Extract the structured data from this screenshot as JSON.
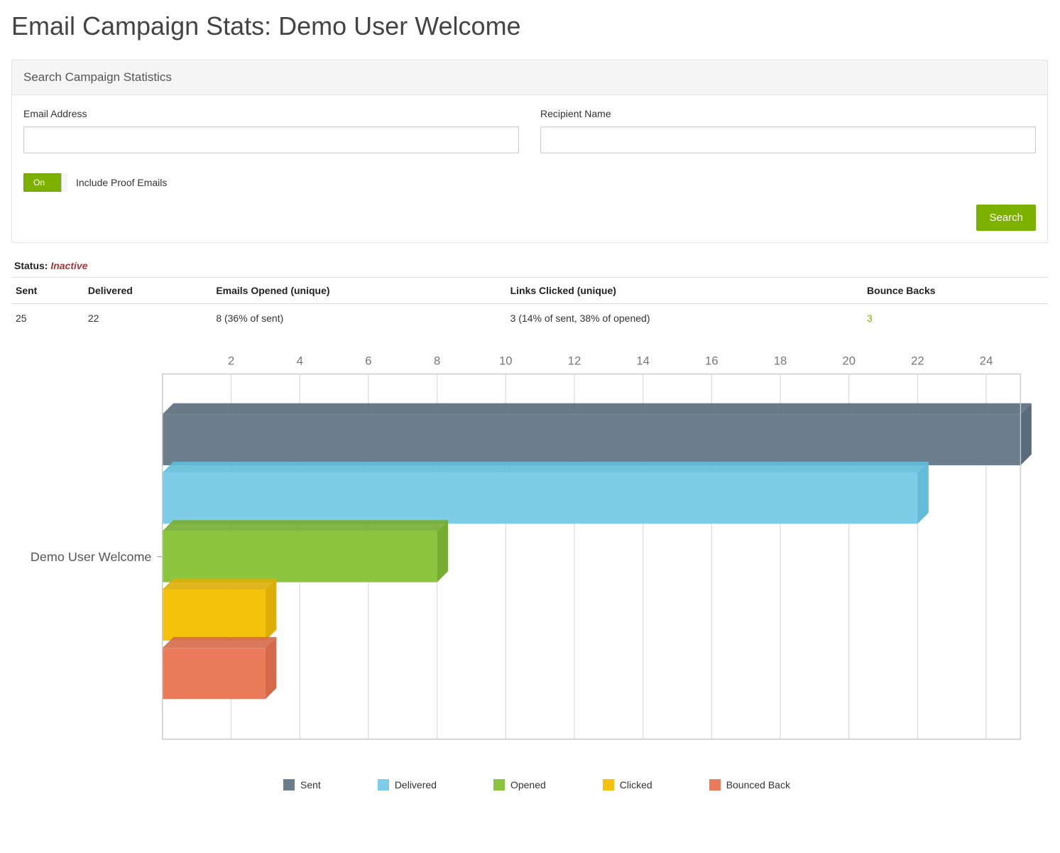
{
  "page": {
    "title": "Email Campaign Stats: Demo User Welcome"
  },
  "search_panel": {
    "heading": "Search Campaign Statistics",
    "email_label": "Email Address",
    "email_value": "",
    "name_label": "Recipient Name",
    "name_value": "",
    "toggle_text": "On",
    "toggle_label": "Include Proof Emails",
    "search_button": "Search"
  },
  "status": {
    "label": "Status:",
    "value": "Inactive"
  },
  "stats_table": {
    "headers": [
      "Sent",
      "Delivered",
      "Emails Opened (unique)",
      "Links Clicked (unique)",
      "Bounce Backs"
    ],
    "row": {
      "sent": "25",
      "delivered": "22",
      "opened": "8 (36% of sent)",
      "clicked": "3 (14% of sent, 38% of opened)",
      "bounced": "3"
    }
  },
  "chart_data": {
    "type": "bar",
    "orientation": "horizontal",
    "categories": [
      "Demo User Welcome"
    ],
    "series": [
      {
        "name": "Sent",
        "values": [
          25
        ],
        "color": "#6c7d8c",
        "shade": "#5a6b79"
      },
      {
        "name": "Delivered",
        "values": [
          22
        ],
        "color": "#7dcde8",
        "shade": "#63bcd9"
      },
      {
        "name": "Opened",
        "values": [
          8
        ],
        "color": "#8bc53f",
        "shade": "#75ad30"
      },
      {
        "name": "Clicked",
        "values": [
          3
        ],
        "color": "#f4c20d",
        "shade": "#dcae06"
      },
      {
        "name": "Bounced Back",
        "values": [
          3
        ],
        "color": "#e97b5a",
        "shade": "#d56a4a"
      }
    ],
    "xticks": [
      2,
      4,
      6,
      8,
      10,
      12,
      14,
      16,
      18,
      20,
      22,
      24
    ],
    "xlim": [
      0,
      25
    ],
    "title": "",
    "xlabel": "",
    "ylabel": "",
    "legend": [
      "Sent",
      "Delivered",
      "Opened",
      "Clicked",
      "Bounced Back"
    ]
  }
}
